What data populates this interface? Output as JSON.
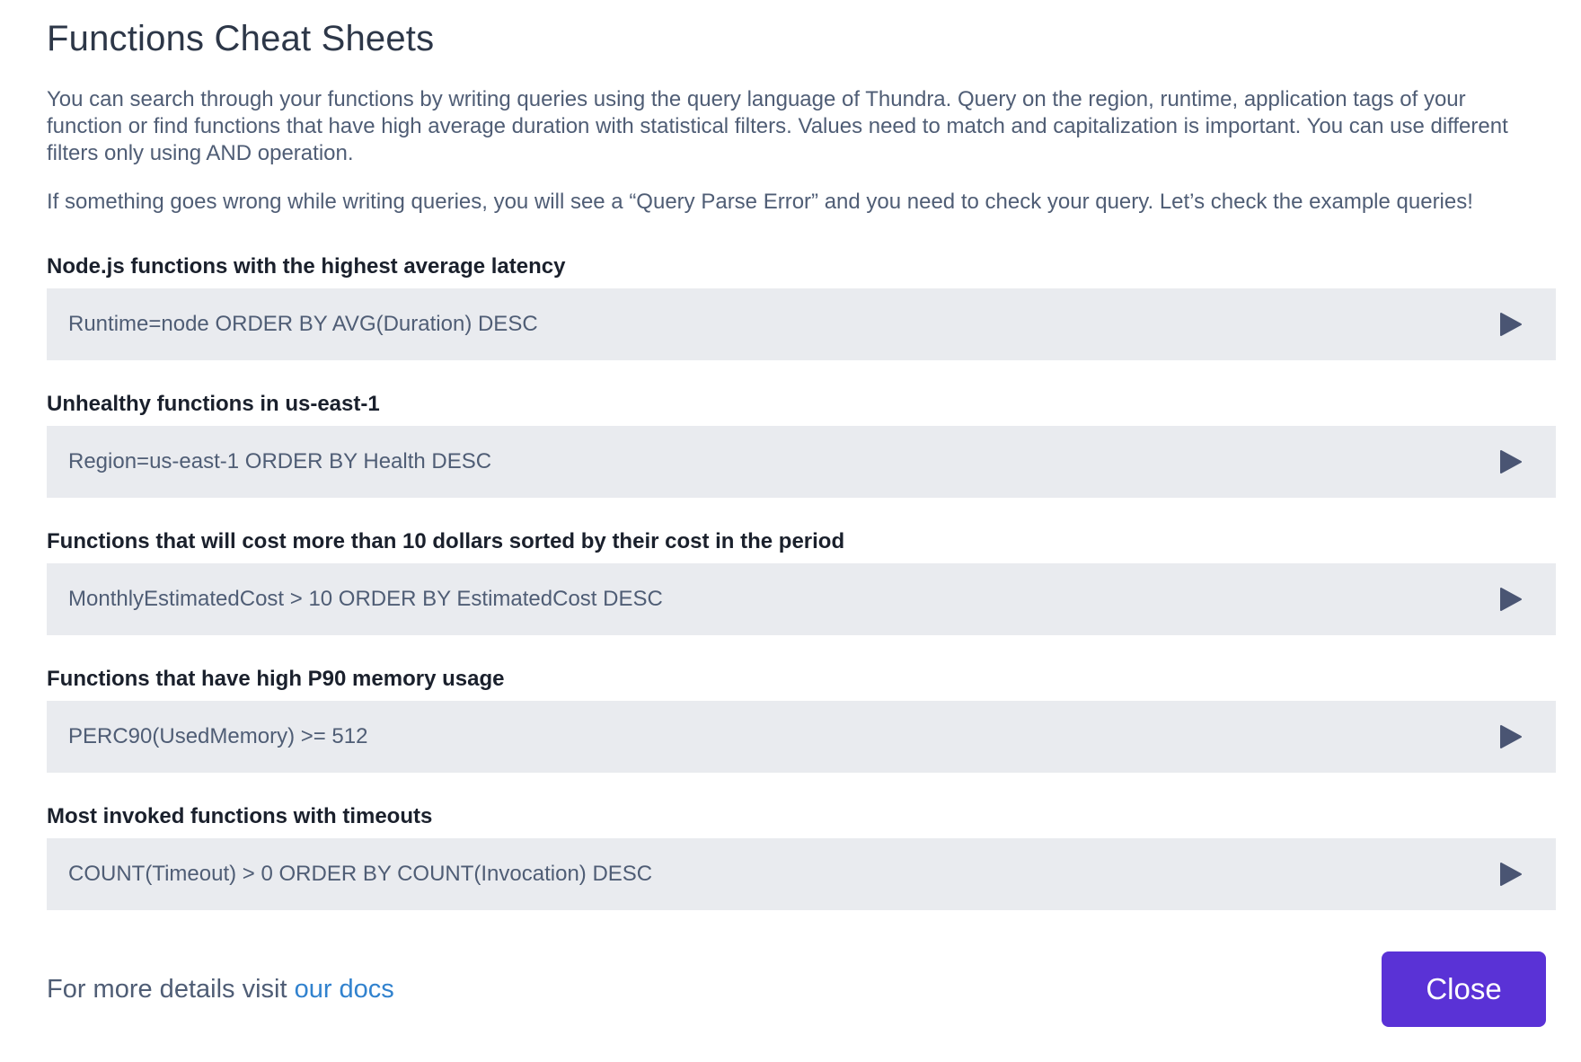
{
  "modal": {
    "title": "Functions Cheat Sheets",
    "intro_paragraphs": [
      "You can search through your functions by writing queries using the query language of Thundra. Query on the region, runtime, application tags of your function or find functions that have high average duration with statistical filters. Values need to match and capitalization is important. You can use different filters only using AND operation.",
      "If something goes wrong while writing queries, you will see a “Query Parse Error” and you need to check your query. Let’s check the example queries!"
    ],
    "examples": [
      {
        "title": "Node.js functions with the highest average latency",
        "query": "Runtime=node ORDER BY AVG(Duration) DESC",
        "icon": "play-icon"
      },
      {
        "title": "Unhealthy functions in us-east-1",
        "query": "Region=us-east-1 ORDER BY Health DESC",
        "icon": "play-icon"
      },
      {
        "title": "Functions that will cost more than 10 dollars sorted by their cost in the period",
        "query": "MonthlyEstimatedCost > 10 ORDER BY EstimatedCost DESC",
        "icon": "play-icon"
      },
      {
        "title": "Functions that have high P90 memory usage",
        "query": "PERC90(UsedMemory) >= 512",
        "icon": "play-icon"
      },
      {
        "title": "Most invoked functions with timeouts",
        "query": "COUNT(Timeout) > 0 ORDER BY COUNT(Invocation) DESC",
        "icon": "play-icon"
      }
    ],
    "footer": {
      "text": "For more details visit ",
      "link_label": "our docs"
    },
    "close_label": "Close"
  },
  "colors": {
    "accent": "#5a32d6",
    "link": "#3182ce",
    "query_bg": "#e9ebef",
    "icon": "#4a5573"
  }
}
